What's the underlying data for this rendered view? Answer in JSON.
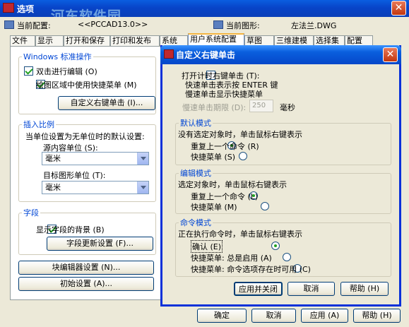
{
  "outer_window": {
    "title": "选项",
    "watermark": "河东软件园",
    "close_icon": "close-icon"
  },
  "profile_row": {
    "current_profile_label": "当前配置:",
    "current_profile_value": "<<PCCAD13.0>>",
    "current_drawing_label": "当前图形:",
    "current_drawing_value": "左法兰.DWG"
  },
  "tabs": [
    "文件",
    "显示",
    "打开和保存",
    "打印和发布",
    "系统",
    "用户系统配置",
    "草图",
    "三维建模",
    "选择集",
    "配置"
  ],
  "active_tab": "用户系统配置",
  "windows_group": {
    "legend": "Windows 标准操作",
    "double_click_edit": "双击进行编辑 (O)",
    "shortcut_menu_in_draw": "绘图区域中使用快捷菜单 (M)",
    "custom_right_click_button": "自定义右键单击 (I)..."
  },
  "insert_group": {
    "legend": "插入比例",
    "unitless_label": "当单位设置为无单位时的默认设置:",
    "source_label": "源内容单位 (S):",
    "source_value": "毫米",
    "target_label": "目标图形单位 (T):",
    "target_value": "毫米"
  },
  "field_group": {
    "legend": "字段",
    "show_background": "显示字段的背景 (B)",
    "update_settings_button": "字段更新设置 (F)..."
  },
  "block_editor_button": "块编辑器设置 (N)...",
  "initial_settings_button": "初始设置 (A)...",
  "bottom_buttons": {
    "ok": "确定",
    "cancel": "取消",
    "apply": "应用 (A)",
    "help": "帮助 (H)"
  },
  "dialog": {
    "title": "自定义右键单击",
    "timed_right_click": "打开计时右键单击 (T):",
    "quick_click_desc": "快速单击表示按 ENTER 键",
    "slow_click_desc": "慢速单击显示快捷菜单",
    "slow_click_duration_label": "慢速单击期限 (D):",
    "slow_click_duration_value": "250",
    "slow_click_unit": "毫秒",
    "default_mode": {
      "legend": "默认模式",
      "desc": "没有选定对象时，单击鼠标右键表示",
      "opt_repeat": "重复上一个命令 (R)",
      "opt_shortcut": "快捷菜单 (S)"
    },
    "edit_mode": {
      "legend": "编辑模式",
      "desc": "选定对象时，单击鼠标右键表示",
      "opt_repeat": "重复上一个命令 (L)",
      "opt_shortcut": "快捷菜单 (M)"
    },
    "command_mode": {
      "legend": "命令模式",
      "desc": "正在执行命令时，单击鼠标右键表示",
      "opt_enter": "确认 (E)",
      "opt_shortcut_always": "快捷菜单: 总是启用 (A)",
      "opt_shortcut_options": "快捷菜单: 命令选项存在时可用 (C)"
    },
    "buttons": {
      "apply_close": "应用并关闭",
      "cancel": "取消",
      "help": "帮助 (H)"
    }
  }
}
